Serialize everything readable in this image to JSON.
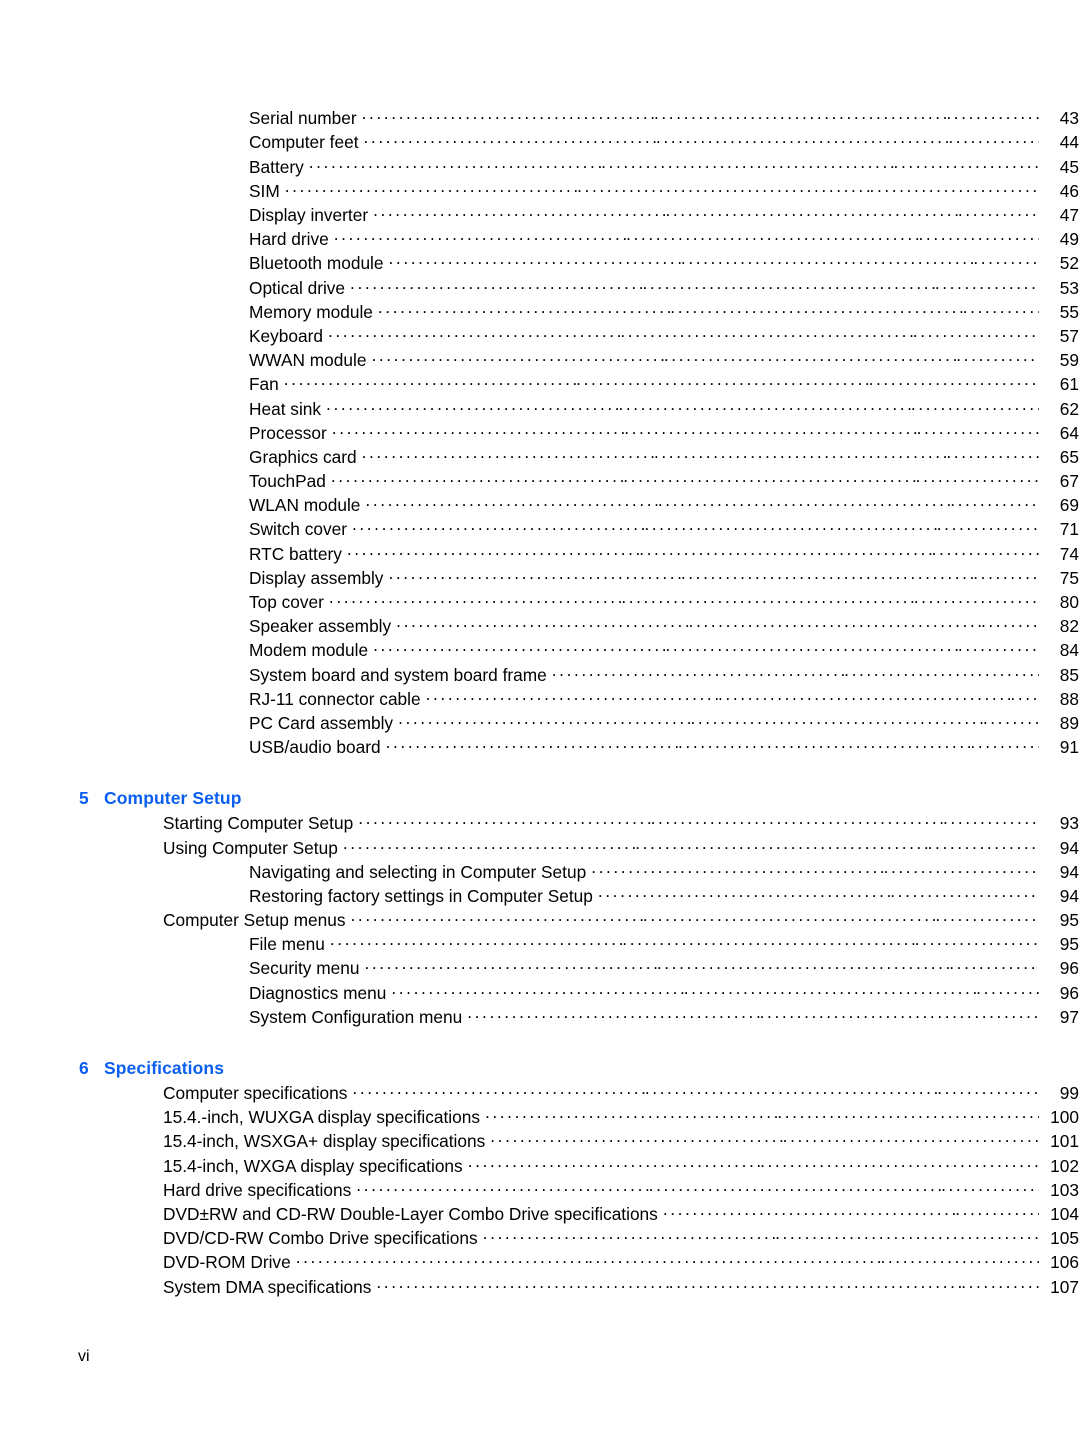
{
  "document": {
    "page_label": "vi",
    "heading_color": "#0a5ff0",
    "text_color": "#000000",
    "background": "#ffffff"
  },
  "toc": {
    "groups": [
      {
        "heading": null,
        "entries": [
          {
            "level": 2,
            "label": "Serial number",
            "page": "43"
          },
          {
            "level": 2,
            "label": "Computer feet",
            "page": "44"
          },
          {
            "level": 2,
            "label": "Battery",
            "page": "45"
          },
          {
            "level": 2,
            "label": "SIM",
            "page": "46"
          },
          {
            "level": 2,
            "label": "Display inverter",
            "page": "47"
          },
          {
            "level": 2,
            "label": "Hard drive",
            "page": "49"
          },
          {
            "level": 2,
            "label": "Bluetooth module",
            "page": "52"
          },
          {
            "level": 2,
            "label": "Optical drive",
            "page": "53"
          },
          {
            "level": 2,
            "label": "Memory module",
            "page": "55"
          },
          {
            "level": 2,
            "label": "Keyboard",
            "page": "57"
          },
          {
            "level": 2,
            "label": "WWAN module",
            "page": "59"
          },
          {
            "level": 2,
            "label": "Fan",
            "page": "61"
          },
          {
            "level": 2,
            "label": "Heat sink",
            "page": "62"
          },
          {
            "level": 2,
            "label": "Processor",
            "page": "64"
          },
          {
            "level": 2,
            "label": "Graphics card",
            "page": "65"
          },
          {
            "level": 2,
            "label": "TouchPad",
            "page": "67"
          },
          {
            "level": 2,
            "label": "WLAN module",
            "page": "69"
          },
          {
            "level": 2,
            "label": "Switch cover",
            "page": "71"
          },
          {
            "level": 2,
            "label": "RTC battery",
            "page": "74"
          },
          {
            "level": 2,
            "label": "Display assembly",
            "page": "75"
          },
          {
            "level": 2,
            "label": "Top cover",
            "page": "80"
          },
          {
            "level": 2,
            "label": "Speaker assembly",
            "page": "82"
          },
          {
            "level": 2,
            "label": "Modem module",
            "page": "84"
          },
          {
            "level": 2,
            "label": "System board and system board frame",
            "page": "85"
          },
          {
            "level": 2,
            "label": "RJ-11 connector cable",
            "page": "88"
          },
          {
            "level": 2,
            "label": "PC Card assembly",
            "page": "89"
          },
          {
            "level": 2,
            "label": "USB/audio board",
            "page": "91"
          }
        ]
      },
      {
        "heading": {
          "number": "5",
          "title": "Computer Setup"
        },
        "entries": [
          {
            "level": 1,
            "label": "Starting Computer Setup",
            "page": "93"
          },
          {
            "level": 1,
            "label": "Using Computer Setup",
            "page": "94"
          },
          {
            "level": 2,
            "label": "Navigating and selecting in Computer Setup",
            "page": "94"
          },
          {
            "level": 2,
            "label": "Restoring factory settings in Computer Setup",
            "page": "94"
          },
          {
            "level": 1,
            "label": "Computer Setup menus",
            "page": "95"
          },
          {
            "level": 2,
            "label": "File menu",
            "page": "95"
          },
          {
            "level": 2,
            "label": "Security menu",
            "page": "96"
          },
          {
            "level": 2,
            "label": "Diagnostics menu",
            "page": "96"
          },
          {
            "level": 2,
            "label": "System Configuration menu",
            "page": "97"
          }
        ]
      },
      {
        "heading": {
          "number": "6",
          "title": "Specifications"
        },
        "entries": [
          {
            "level": 1,
            "label": "Computer specifications",
            "page": "99"
          },
          {
            "level": 1,
            "label": "15.4.-inch, WUXGA display specifications",
            "page": "100"
          },
          {
            "level": 1,
            "label": "15.4-inch, WSXGA+ display specifications",
            "page": "101"
          },
          {
            "level": 1,
            "label": "15.4-inch, WXGA display specifications",
            "page": "102"
          },
          {
            "level": 1,
            "label": "Hard drive specifications",
            "page": "103"
          },
          {
            "level": 1,
            "label": "DVD±RW and CD-RW Double-Layer Combo Drive specifications",
            "page": "104"
          },
          {
            "level": 1,
            "label": "DVD/CD-RW Combo Drive specifications",
            "page": "105"
          },
          {
            "level": 1,
            "label": "DVD-ROM Drive",
            "page": "106"
          },
          {
            "level": 1,
            "label": "System DMA specifications",
            "page": "107"
          }
        ]
      }
    ]
  }
}
